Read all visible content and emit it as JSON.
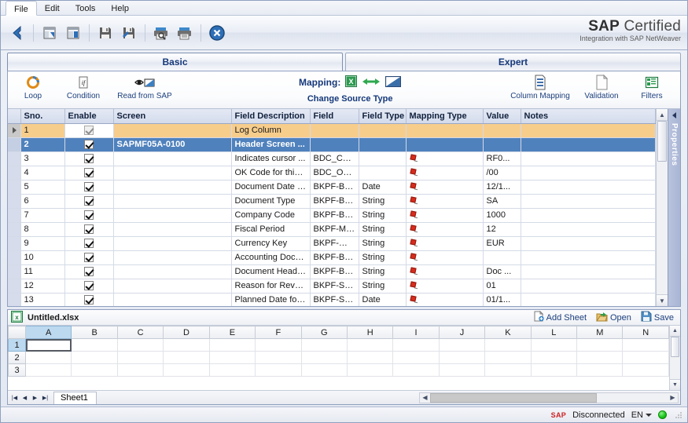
{
  "menu": {
    "items": [
      {
        "label": "File",
        "active": true
      },
      {
        "label": "Edit",
        "active": false
      },
      {
        "label": "Tools",
        "active": false
      },
      {
        "label": "Help",
        "active": false
      }
    ]
  },
  "toolbar": {
    "buttons": [
      {
        "name": "back-icon",
        "title": "Back"
      },
      {
        "name": "new-window-icon",
        "title": "New Window"
      },
      {
        "name": "open-window-icon",
        "title": "Open Window"
      },
      {
        "name": "save-icon",
        "title": "Save"
      },
      {
        "name": "save-as-icon",
        "title": "Save As"
      },
      {
        "name": "print-preview-icon",
        "title": "Print Preview"
      },
      {
        "name": "print-icon",
        "title": "Print"
      },
      {
        "name": "cancel-icon",
        "title": "Cancel"
      }
    ]
  },
  "branding": {
    "line1_bold": "SAP",
    "line1_rest": " Certified",
    "line2": "Integration with SAP NetWeaver"
  },
  "tabs": [
    {
      "label": "Basic",
      "active": true
    },
    {
      "label": "Expert",
      "active": false
    }
  ],
  "ribbon": {
    "left_items": [
      {
        "label": "Loop",
        "icon": "loop-icon"
      },
      {
        "label": "Condition",
        "icon": "condition-icon"
      },
      {
        "label": "Read from SAP",
        "icon": "read-from-sap-icon"
      }
    ],
    "mapping_label": "Mapping:",
    "mapping_icons": [
      "excel-icon",
      "swap-arrows-icon",
      "shape-icon"
    ],
    "change_source_type": "Change Source Type",
    "right_items": [
      {
        "label": "Column Mapping",
        "icon": "column-mapping-icon"
      },
      {
        "label": "Validation",
        "icon": "validation-icon"
      },
      {
        "label": "Filters",
        "icon": "filters-icon"
      }
    ]
  },
  "properties_panel": {
    "label": "Properties"
  },
  "grid": {
    "columns": [
      "Sno.",
      "Enable",
      "Screen",
      "Field Description",
      "Field",
      "Field Type",
      "Mapping Type",
      "Value",
      "Notes"
    ],
    "rows": [
      {
        "sno": "1",
        "enable": true,
        "screen": "",
        "field_description": "Log Column",
        "field": "",
        "field_type": "",
        "mapping_type": "",
        "value": "",
        "notes": "",
        "style": "highlight",
        "marker": true
      },
      {
        "sno": "2",
        "enable": true,
        "screen": "SAPMF05A-0100",
        "field_description": "Header Screen ...",
        "field": "",
        "field_type": "",
        "mapping_type": "",
        "value": "",
        "notes": "",
        "style": "selected",
        "marker": false
      },
      {
        "sno": "3",
        "enable": true,
        "screen": "",
        "field_description": "Indicates cursor ...",
        "field": "BDC_CUR...",
        "field_type": "",
        "mapping_type": "pin",
        "value": "RF0...",
        "notes": "",
        "style": "",
        "marker": false
      },
      {
        "sno": "4",
        "enable": true,
        "screen": "",
        "field_description": "OK Code for this ...",
        "field": "BDC_OKC...",
        "field_type": "",
        "mapping_type": "pin",
        "value": "/00",
        "notes": "",
        "style": "",
        "marker": false
      },
      {
        "sno": "5",
        "enable": true,
        "screen": "",
        "field_description": "Document Date in...",
        "field": "BKPF-BLDAT",
        "field_type": "Date",
        "mapping_type": "pin",
        "value": "12/1...",
        "notes": "",
        "style": "",
        "marker": false
      },
      {
        "sno": "6",
        "enable": true,
        "screen": "",
        "field_description": "Document Type",
        "field": "BKPF-BLART",
        "field_type": "String",
        "mapping_type": "pin",
        "value": "SA",
        "notes": "",
        "style": "",
        "marker": false
      },
      {
        "sno": "7",
        "enable": true,
        "screen": "",
        "field_description": "Company Code",
        "field": "BKPF-BUKRS",
        "field_type": "String",
        "mapping_type": "pin",
        "value": "1000",
        "notes": "",
        "style": "",
        "marker": false
      },
      {
        "sno": "8",
        "enable": true,
        "screen": "",
        "field_description": "Fiscal Period",
        "field": "BKPF-MO...",
        "field_type": "String",
        "mapping_type": "pin",
        "value": "12",
        "notes": "",
        "style": "",
        "marker": false
      },
      {
        "sno": "9",
        "enable": true,
        "screen": "",
        "field_description": "Currency Key",
        "field": "BKPF-WA...",
        "field_type": "String",
        "mapping_type": "pin",
        "value": "EUR",
        "notes": "",
        "style": "",
        "marker": false
      },
      {
        "sno": "10",
        "enable": true,
        "screen": "",
        "field_description": "Accounting Docu...",
        "field": "BKPF-BELNR",
        "field_type": "String",
        "mapping_type": "pin",
        "value": "",
        "notes": "",
        "style": "",
        "marker": false
      },
      {
        "sno": "11",
        "enable": true,
        "screen": "",
        "field_description": "Document Heade...",
        "field": "BKPF-BKTXT",
        "field_type": "String",
        "mapping_type": "pin",
        "value": "Doc ...",
        "notes": "",
        "style": "",
        "marker": false
      },
      {
        "sno": "12",
        "enable": true,
        "screen": "",
        "field_description": "Reason for Rever...",
        "field": "BKPF-STGRD",
        "field_type": "String",
        "mapping_type": "pin",
        "value": "01",
        "notes": "",
        "style": "",
        "marker": false
      },
      {
        "sno": "13",
        "enable": true,
        "screen": "",
        "field_description": "Planned Date for ...",
        "field": "BKPF-STODT",
        "field_type": "Date",
        "mapping_type": "pin",
        "value": "01/1...",
        "notes": "",
        "style": "",
        "marker": false
      }
    ]
  },
  "spreadsheet": {
    "file_name": "Untitled.xlsx",
    "actions": [
      {
        "label": "Add Sheet",
        "icon": "add-sheet-icon"
      },
      {
        "label": "Open",
        "icon": "open-folder-icon"
      },
      {
        "label": "Save",
        "icon": "save-disk-icon"
      }
    ],
    "columns": [
      "A",
      "B",
      "C",
      "D",
      "E",
      "F",
      "G",
      "H",
      "I",
      "J",
      "K",
      "L",
      "M",
      "N"
    ],
    "rows": [
      "1",
      "2",
      "3"
    ],
    "selected_cell": "A1",
    "sheet_tab": "Sheet1"
  },
  "statusbar": {
    "sap_mark": "SAP",
    "connection": "Disconnected",
    "language": "EN",
    "indicator_color": "#15c315"
  }
}
